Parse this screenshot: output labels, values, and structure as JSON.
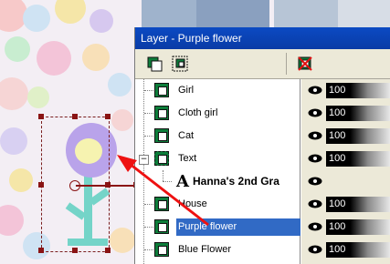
{
  "palette": {
    "title": "Layer - Purple flower",
    "toolbar": {
      "new_layer_icon": "layer-icon",
      "new_group_icon": "layer-group-icon",
      "delete_icon": "delete-layer-icon"
    },
    "layers": [
      {
        "name": "Girl",
        "type": "raster",
        "opacity": "100",
        "visible": true
      },
      {
        "name": "Cloth girl",
        "type": "raster",
        "opacity": "100",
        "visible": true
      },
      {
        "name": "Cat",
        "type": "raster",
        "opacity": "100",
        "visible": true
      },
      {
        "name": "Text",
        "type": "group",
        "opacity": "100",
        "visible": true,
        "expanded": true,
        "expander": "−"
      },
      {
        "name": "Hanna's 2nd Gra",
        "type": "text",
        "icon_letter": "A",
        "visible": true
      },
      {
        "name": "House",
        "type": "raster",
        "opacity": "100",
        "visible": true
      },
      {
        "name": "Purple flower",
        "type": "raster",
        "opacity": "100",
        "visible": true,
        "selected": true
      },
      {
        "name": "Blue Flower",
        "type": "raster",
        "opacity": "100",
        "visible": true
      }
    ]
  },
  "colors": {
    "selection_highlight": "#316ac5",
    "titlebar": "#0b4ac3",
    "arrow": "#ee1111",
    "selection_handles": "#8a1414",
    "flower_petals": "#b9a3ea",
    "flower_stem": "#74d4c8"
  }
}
